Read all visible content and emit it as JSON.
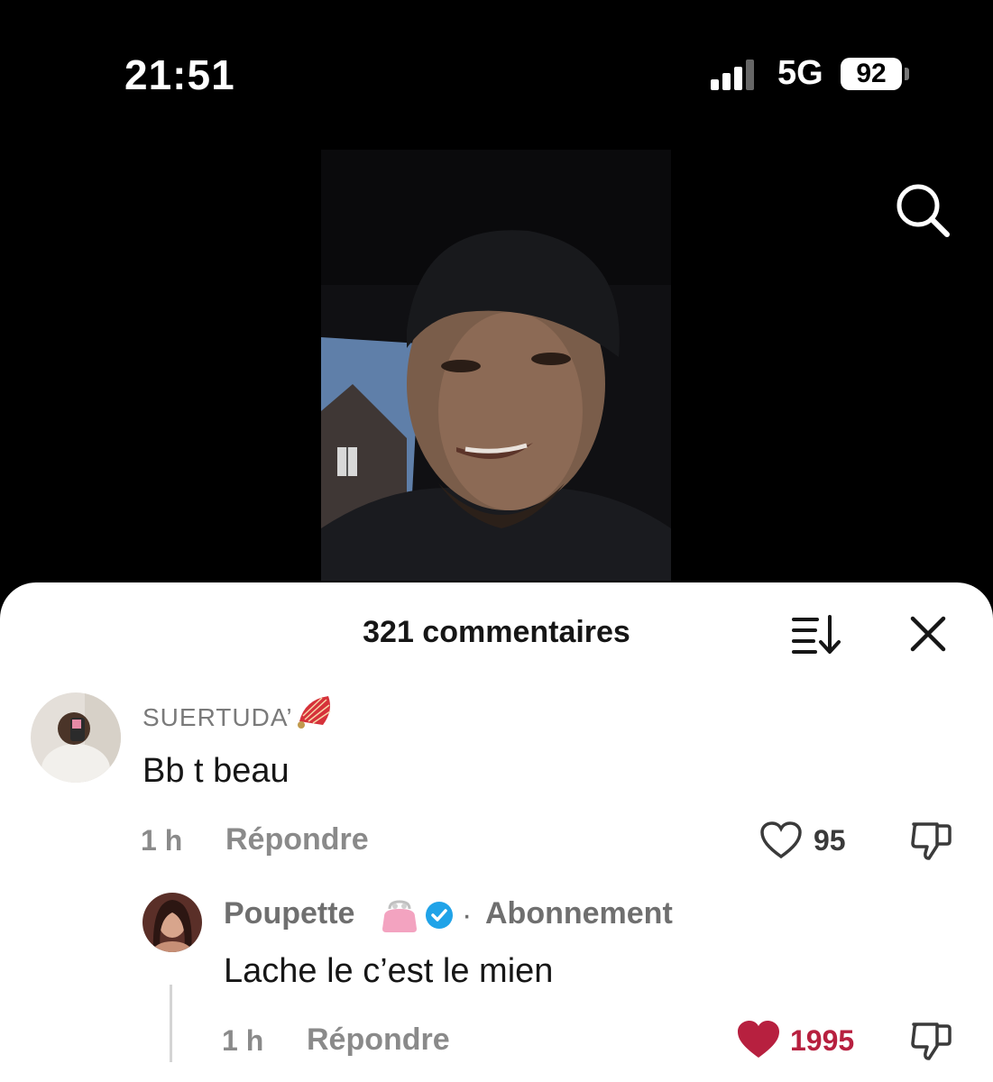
{
  "status_bar": {
    "time": "21:51",
    "network": "5G",
    "battery": "92"
  },
  "comments_panel": {
    "title": "321 commentaires",
    "comments": [
      {
        "username": "SUERTUDA’",
        "username_emoji": "fan-emoji",
        "text": "Bb t beau",
        "time": "1 h",
        "reply_label": "Répondre",
        "likes": "95",
        "liked": false
      },
      {
        "username": "Poupette",
        "username_emoji": "purse-emoji",
        "verified": true,
        "separator": "·",
        "follow_label": "Abonnement",
        "text": "Lache le c’est le mien",
        "time": "1 h",
        "reply_label": "Répondre",
        "likes": "1995",
        "liked": true
      }
    ]
  },
  "colors": {
    "background": "#000000",
    "sheet": "#ffffff",
    "like_active": "#b7203f",
    "verified": "#20a3e8",
    "muted_text": "#8a8a8a"
  }
}
